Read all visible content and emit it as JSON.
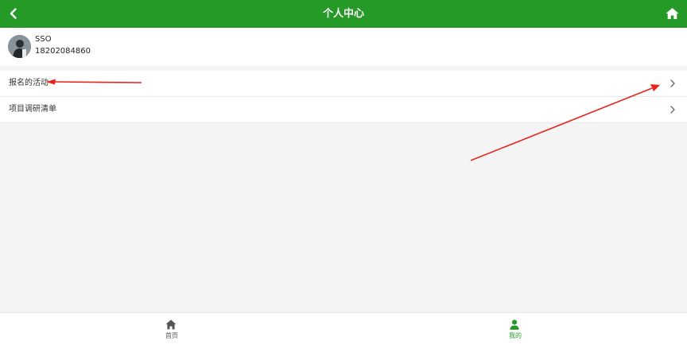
{
  "header": {
    "title": "个人中心",
    "back_icon": "chevron-left-icon",
    "home_icon": "home-icon",
    "background_color": "#259a27"
  },
  "profile": {
    "username": "SSO",
    "phone": "18202084860",
    "avatar_icon": "avatar-image"
  },
  "menu": {
    "items": [
      {
        "label": "报名的活动",
        "icon": "chevron-right-icon"
      },
      {
        "label": "项目调研清单",
        "icon": "chevron-right-icon"
      }
    ]
  },
  "annotations": {
    "arrow_color": "#e8231e",
    "arrows": [
      "arrow-pointing-to-menu-label",
      "arrow-pointing-to-chevron"
    ]
  },
  "tabbar": {
    "tabs": [
      {
        "label": "首页",
        "icon": "home-icon",
        "active": false
      },
      {
        "label": "我的",
        "icon": "person-icon",
        "active": true
      }
    ],
    "active_color": "#259a27"
  }
}
